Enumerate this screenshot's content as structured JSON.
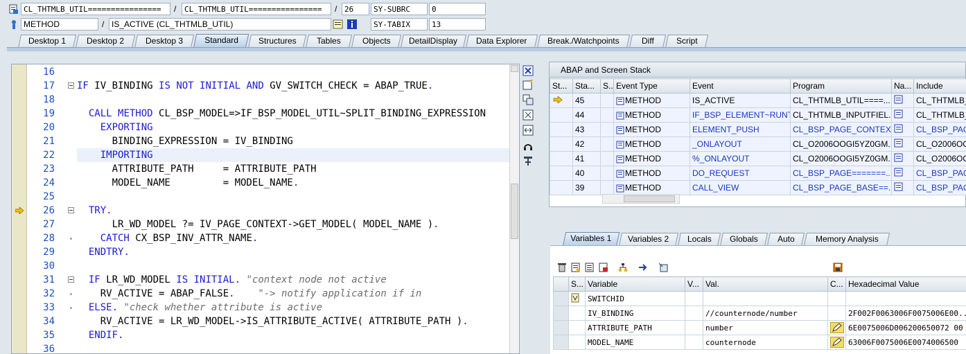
{
  "header": {
    "row1": {
      "field_a": "CL_THTMLB_UTIL================",
      "field_b": "CL_THTMLB_UTIL================",
      "line": "26",
      "sysvar_name": "SY-SUBRC",
      "sysvar_value": "0"
    },
    "row2": {
      "event_type": "METHOD",
      "event_name": "IS_ACTIVE (CL_THTMLB_UTIL)",
      "sysvar_name": "SY-TABIX",
      "sysvar_value": "13"
    },
    "separator": "/"
  },
  "main_tabs": [
    "Desktop 1",
    "Desktop 2",
    "Desktop 3",
    "Standard",
    "Structures",
    "Tables",
    "Objects",
    "DetailDisplay",
    "Data Explorer",
    "Break./Watchpoints",
    "Diff",
    "Script"
  ],
  "active_main_tab": "Standard",
  "editor": {
    "lines": [
      {
        "no": "16",
        "text": ""
      },
      {
        "no": "17",
        "text": "IF IV_BINDING IS NOT INITIAL AND GV_SWITCH_CHECK = ABAP_TRUE."
      },
      {
        "no": "18",
        "text": ""
      },
      {
        "no": "19",
        "text": "  CALL METHOD CL_BSP_MODEL=>IF_BSP_MODEL_UTIL~SPLIT_BINDING_EXPRESSION"
      },
      {
        "no": "20",
        "text": "    EXPORTING"
      },
      {
        "no": "21",
        "text": "      BINDING_EXPRESSION = IV_BINDING"
      },
      {
        "no": "22",
        "text": "    IMPORTING"
      },
      {
        "no": "23",
        "text": "      ATTRIBUTE_PATH     = ATTRIBUTE_PATH"
      },
      {
        "no": "24",
        "text": "      MODEL_NAME         = MODEL_NAME."
      },
      {
        "no": "25",
        "text": ""
      },
      {
        "no": "26",
        "text": "  TRY."
      },
      {
        "no": "27",
        "text": "      LR_WD_MODEL ?= IV_PAGE_CONTEXT->GET_MODEL( MODEL_NAME )."
      },
      {
        "no": "28",
        "text": "    CATCH CX_BSP_INV_ATTR_NAME."
      },
      {
        "no": "29",
        "text": "  ENDTRY."
      },
      {
        "no": "30",
        "text": ""
      },
      {
        "no": "31",
        "text": "  IF LR_WD_MODEL IS INITIAL. \"context node not active"
      },
      {
        "no": "32",
        "text": "    RV_ACTIVE = ABAP_FALSE.    \"-> notify application if in"
      },
      {
        "no": "33",
        "text": "  ELSE. \"check whether attribute is active"
      },
      {
        "no": "34",
        "text": "    RV_ACTIVE = LR_WD_MODEL->IS_ATTRIBUTE_ACTIVE( ATTRIBUTE_PATH )."
      },
      {
        "no": "35",
        "text": "  ENDIF."
      },
      {
        "no": "36",
        "text": ""
      }
    ]
  },
  "stack": {
    "title": "ABAP and Screen Stack",
    "columns": [
      "St...",
      "Sta...",
      "S...",
      "Event Type",
      "Event",
      "Program",
      "Na...",
      "Include"
    ],
    "rows": [
      {
        "level": "45",
        "event_type": "METHOD",
        "event": "IS_ACTIVE",
        "program": "CL_THTMLB_UTIL====...",
        "include": "CL_THTMLB_UTIL",
        "current": true
      },
      {
        "level": "44",
        "event_type": "METHOD",
        "event": "IF_BSP_ELEMENT~RUNT...",
        "program": "CL_THTMLB_INPUTFIEL...",
        "include": "CL_THTMLB_IN",
        "current": false
      },
      {
        "level": "43",
        "event_type": "METHOD",
        "event": "ELEMENT_PUSH",
        "program": "CL_BSP_PAGE_CONTEX...",
        "include": "CL_BSP_PAGE",
        "current": false
      },
      {
        "level": "42",
        "event_type": "METHOD",
        "event": "_ONLAYOUT",
        "program": "CL_O2006OOGI5YZ0GM...",
        "include": "CL_O2006OO",
        "current": false
      },
      {
        "level": "41",
        "event_type": "METHOD",
        "event": "%_ONLAYOUT",
        "program": "CL_O2006OOGI5YZ0GM...",
        "include": "CL_O2006OO",
        "current": false
      },
      {
        "level": "40",
        "event_type": "METHOD",
        "event": "DO_REQUEST",
        "program": "CL_BSP_PAGE=======...",
        "include": "CL_BSP_PAGE",
        "current": false
      },
      {
        "level": "39",
        "event_type": "METHOD",
        "event": "CALL_VIEW",
        "program": "CL_BSP_PAGE_BASE==...",
        "include": "CL_BSP_PAGE",
        "current": false
      }
    ]
  },
  "var_tabs": [
    "Variables 1",
    "Variables 2",
    "Locals",
    "Globals",
    "Auto",
    "Memory Analysis"
  ],
  "active_var_tab": "Variables 1",
  "variables": {
    "columns": [
      "S...",
      "Variable",
      "V...",
      "Val.",
      "C...",
      "Hexadecimal Value"
    ],
    "rows": [
      {
        "variable": "SWITCHID",
        "value": "",
        "hex": "",
        "editable": false
      },
      {
        "variable": "IV_BINDING",
        "value": "//counternode/number",
        "hex": "2F002F0063006F0075006E00...",
        "editable": false
      },
      {
        "variable": "ATTRIBUTE_PATH",
        "value": "number",
        "hex": "6E0075006D006200650072 00",
        "editable": true
      },
      {
        "variable": "MODEL_NAME",
        "value": "counternode",
        "hex": "63006F0075006E0074006500",
        "editable": true
      }
    ]
  },
  "colors": {
    "keyword": "#1a1ad6",
    "comment": "#6d6d6d",
    "stack_link": "#1637c5",
    "active_tab": "#b8cfe6"
  }
}
